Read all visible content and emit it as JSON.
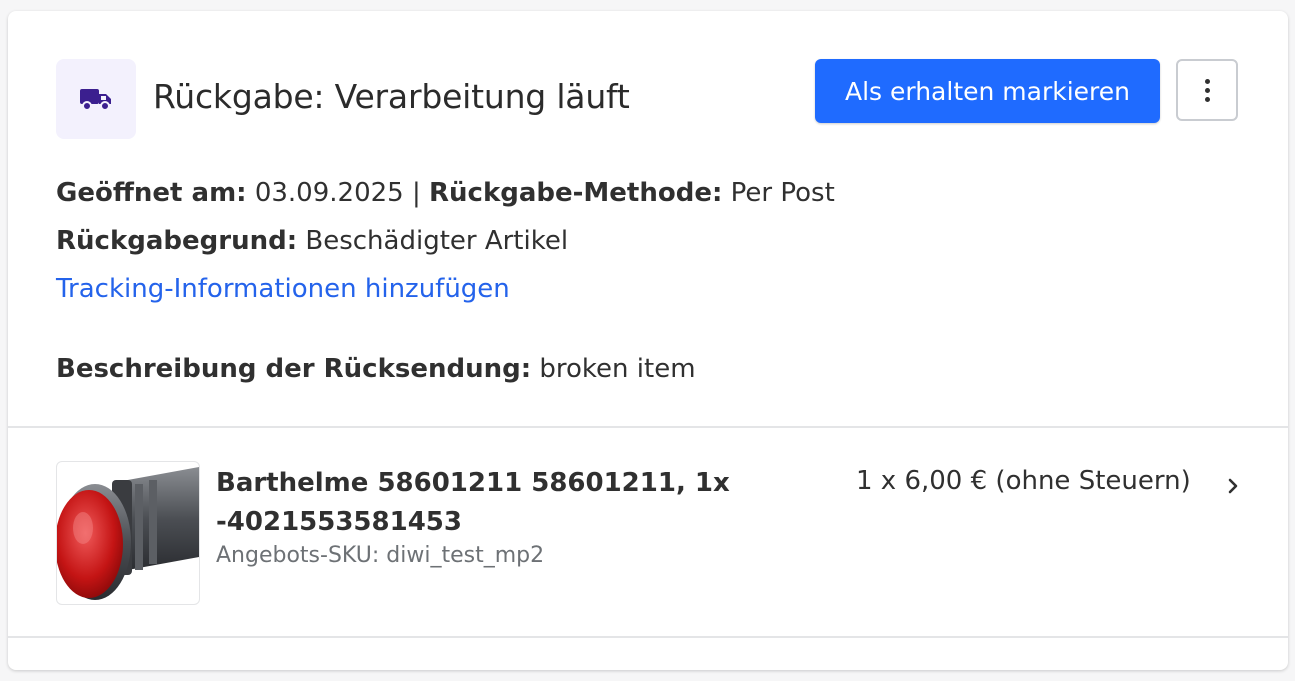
{
  "header": {
    "icon": "truck-icon",
    "title": "Rückgabe: Verarbeitung läuft",
    "primary_action": "Als erhalten markieren",
    "more_icon": "more-vertical-icon"
  },
  "details": {
    "opened_label": "Geöffnet am:",
    "opened_value": "03.09.2025",
    "separator": "|",
    "method_label": "Rückgabe-Methode:",
    "method_value": "Per Post",
    "reason_label": "Rückgabegrund:",
    "reason_value": "Beschädigter Artikel",
    "tracking_link": "Tracking-Informationen hinzufügen",
    "description_label": "Beschreibung der Rücksendung:",
    "description_value": "broken item"
  },
  "item": {
    "image": "red-indicator-lamp-product-image",
    "name": "Barthelme 58601211 58601211, 1x -4021553581453",
    "sku_label": "Angebots-SKU:",
    "sku_value": "diwi_test_mp2",
    "price": "1 x 6,00 € (ohne Steuern)",
    "chevron": "chevron-right-icon"
  },
  "colors": {
    "primary": "#1f6bff",
    "link": "#2463eb",
    "icon_bg": "#f3f1fd",
    "icon": "#3b1f8f"
  }
}
